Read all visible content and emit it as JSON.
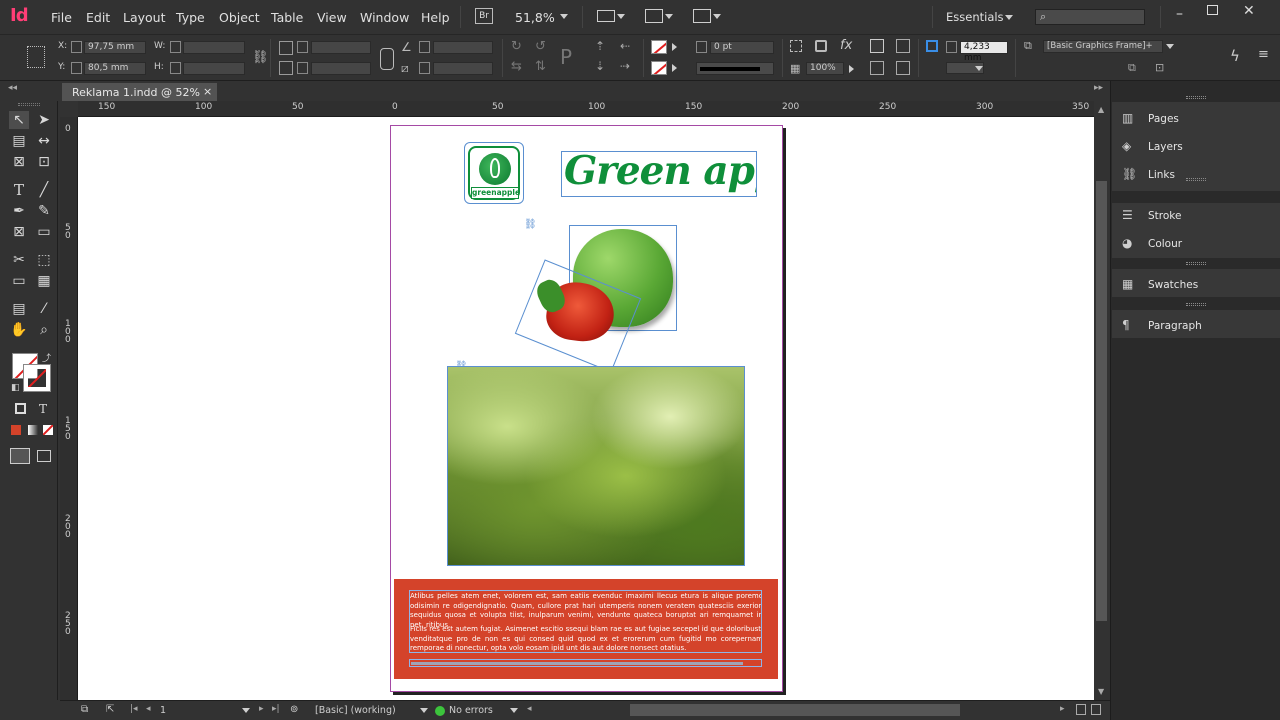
{
  "app": {
    "logo": "Id",
    "zoom": "51,8%",
    "workspace": "Essentials",
    "br": "Br"
  },
  "menu": [
    "File",
    "Edit",
    "Layout",
    "Type",
    "Object",
    "Table",
    "View",
    "Window",
    "Help"
  ],
  "control": {
    "x_label": "X:",
    "x_value": "97,75 mm",
    "y_label": "Y:",
    "y_value": "80,5 mm",
    "w_label": "W:",
    "h_label": "H:",
    "stroke_weight": "0 pt",
    "opacity": "100%",
    "gutter": "4,233 mm",
    "object_style": "[Basic Graphics Frame]+"
  },
  "document_tab": {
    "title": "Reklama 1.indd @ 52%",
    "close": "×"
  },
  "ruler": {
    "h_ticks": [
      "150",
      "100",
      "50",
      "0",
      "50",
      "100",
      "150",
      "200",
      "250",
      "300",
      "350"
    ],
    "v_ticks": [
      "0",
      "5\n0",
      "1\n0\n0",
      "1\n5\n0",
      "2\n0\n0",
      "2\n5\n0"
    ]
  },
  "page_content": {
    "logo_text": "greenapple",
    "headline": "Green apple",
    "body_p1": "Atlibus pelles atem enet, volorem est, sam eatiis evenduc imaximi llecus etura is alique poremo odisimin re odigendignatio. Quam, cullore prat hari utemperis nonem veratem quatesciis exerion sequidus quosa et volupta tiist, inulparum venimi, vendunte quateca boruptat ari remquamet in net, ritibus.",
    "body_p2": "Ficiis res est autem fugiat. Asimenet escitio ssequi blam rae es aut fugiae secepel id que doloribusti venditatque pro de non es qui consed quid quod ex et erorerum cum fugitid mo corepernam remporae di nonectur, opta volo eosam ipid unt dis aut dolore nonsect otatius."
  },
  "status": {
    "page_number": "1",
    "preflight_profile": "[Basic] (working)",
    "errors": "No errors"
  },
  "panels": {
    "group1": [
      "Pages",
      "Layers",
      "Links"
    ],
    "group2": [
      "Stroke",
      "Colour"
    ],
    "group3": [
      "Swatches"
    ],
    "group4": [
      "Paragraph"
    ]
  },
  "colors": {
    "accent_brand": "#ff3e76",
    "headline_green": "#0f8f3a",
    "text_box_red": "#d4432a",
    "frame_blue": "#5a8fd0"
  }
}
